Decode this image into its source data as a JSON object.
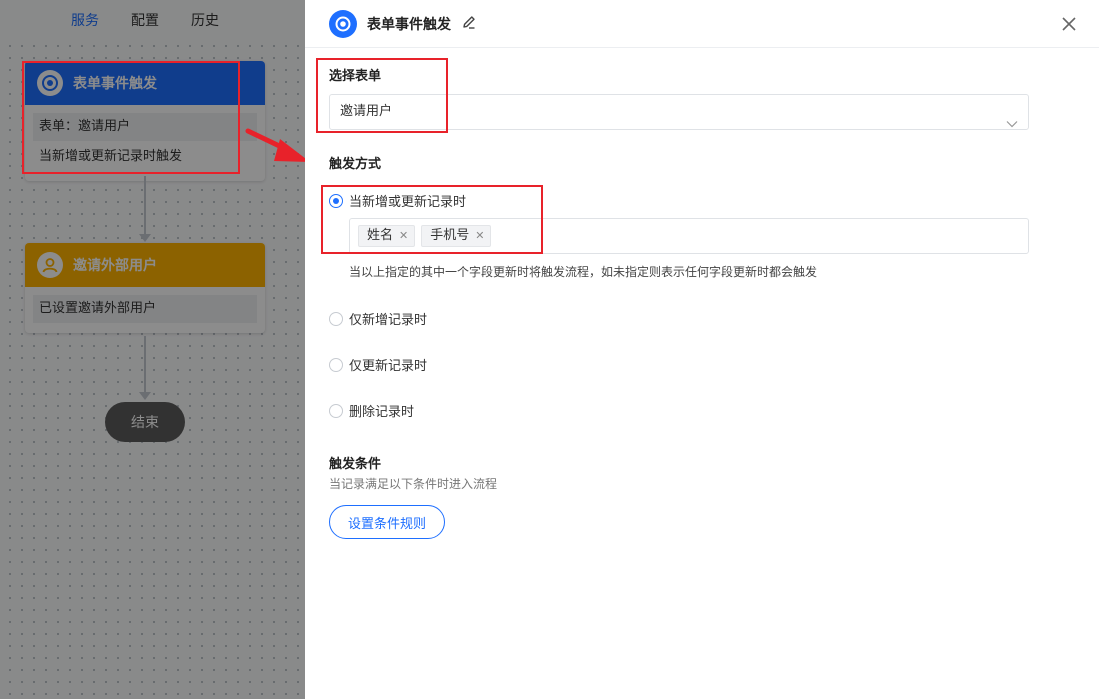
{
  "nav": {
    "tabs": [
      "服务",
      "配置",
      "历史"
    ]
  },
  "canvas": {
    "trigger_node": {
      "title": "表单事件触发",
      "form_line": "表单：邀请用户",
      "event_line": "当新增或更新记录时触发"
    },
    "invite_node": {
      "title": "邀请外部用户",
      "status_line": "已设置邀请外部用户"
    },
    "end_node": {
      "label": "结束"
    }
  },
  "panel": {
    "title": "表单事件触发",
    "select_form": {
      "label": "选择表单",
      "value": "邀请用户"
    },
    "trigger_mode": {
      "label": "触发方式",
      "options": [
        "当新增或更新记录时",
        "仅新增记录时",
        "仅更新记录时",
        "删除记录时"
      ],
      "selected": "当新增或更新记录时",
      "fields": [
        "姓名",
        "手机号"
      ],
      "hint": "当以上指定的其中一个字段更新时将触发流程，如未指定则表示任何字段更新时都会触发"
    },
    "conditions": {
      "label": "触发条件",
      "description": "当记录满足以下条件时进入流程",
      "button": "设置条件规则"
    }
  },
  "colors": {
    "accent": "#1e6fff",
    "trigger_header": "#1e6fff",
    "invite_header": "#ffb300",
    "annotation_red": "#e8222a"
  },
  "icons": [
    "target-icon",
    "user-icon",
    "edit-icon",
    "close-icon",
    "chevron-down-icon",
    "remove-tag-icon"
  ]
}
